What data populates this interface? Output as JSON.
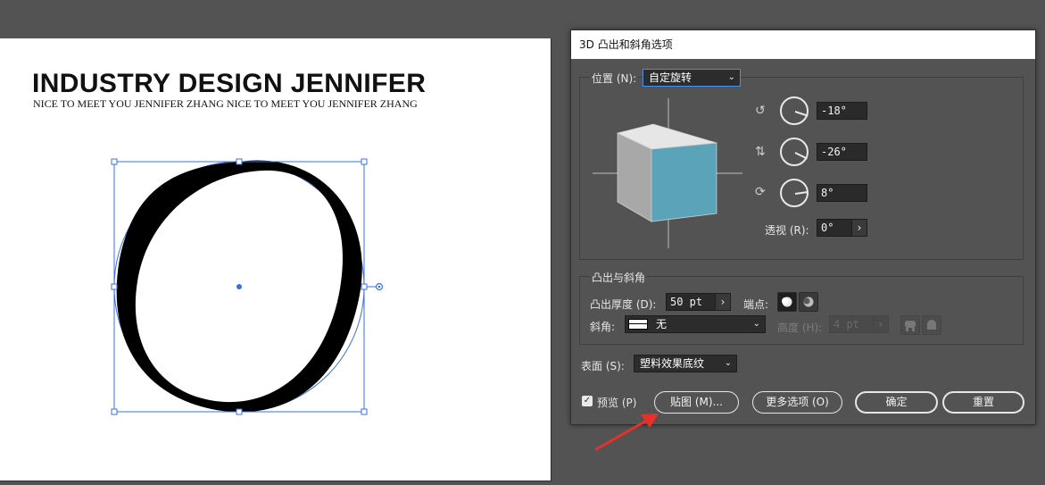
{
  "artboard": {
    "title": "INDUSTRY DESIGN JENNIFER",
    "subtitle": "NICE TO MEET YOU JENNIFER ZHANG  NICE TO MEET YOU JENNIFER ZHANG"
  },
  "dialog": {
    "title": "3D 凸出和斜角选项",
    "position_label": "位置 (N):",
    "position_value": "自定旋转",
    "rotation": {
      "x_value": "-18°",
      "y_value": "-26°",
      "z_value": "8°",
      "perspective_label": "透视 (R):",
      "perspective_value": "0°"
    },
    "extrude_section_title": "凸出与斜角",
    "extrude_depth_label": "凸出厚度 (D):",
    "extrude_depth_value": "50 pt",
    "cap_label": "端点:",
    "bevel_label": "斜角:",
    "bevel_value": "无",
    "height_label": "高度 (H):",
    "height_value": "4 pt",
    "surface_label": "表面 (S):",
    "surface_value": "塑料效果底纹",
    "preview_label": "预览 (P)",
    "preview_checked": true,
    "map_button": "贴图 (M)...",
    "more_options_button": "更多选项 (O)",
    "ok_button": "确定",
    "reset_button": "重置"
  },
  "colors": {
    "cube_front": "#5aa3b9",
    "cube_top": "#e6e6e6",
    "cube_side": "#a8a8a8",
    "selection_blue": "#3b6fe0",
    "annotation_arrow": "#e8302a"
  }
}
